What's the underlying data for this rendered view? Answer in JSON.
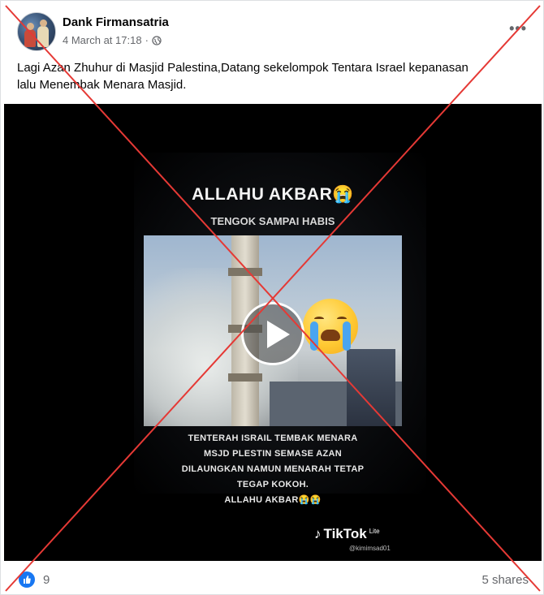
{
  "post": {
    "author": "Dank Firmansatria",
    "timestamp": "4 March at 17:18",
    "privacy_icon": "globe-icon",
    "more_label": "•••",
    "text_line1": "Lagi Azan Zhuhur di Masjid Palestina,Datang sekelompok Tentara Israel kepanasan",
    "text_line2": "lalu Menembak Menara Masjid."
  },
  "video": {
    "title": "ALLAHU AKBAR😭",
    "subtitle": "TENGOK SAMPAI HABIS",
    "caption_lines": [
      "TENTERAH ISRAIL TEMBAK MENARA",
      "MSJD PLESTIN SEMASE AZAN",
      "DILAUNGKAN NAMUN MENARAH TETAP",
      "TEGAP KOKOH.",
      "ALLAHU AKBAR😭😭"
    ],
    "brand": "TikTok",
    "brand_suffix": "Lite",
    "handle": "@kimimsad01"
  },
  "footer": {
    "reaction_icon": "like-icon",
    "reaction_count": "9",
    "shares": "5 shares"
  },
  "overlay": {
    "cross_color": "#e53935"
  }
}
